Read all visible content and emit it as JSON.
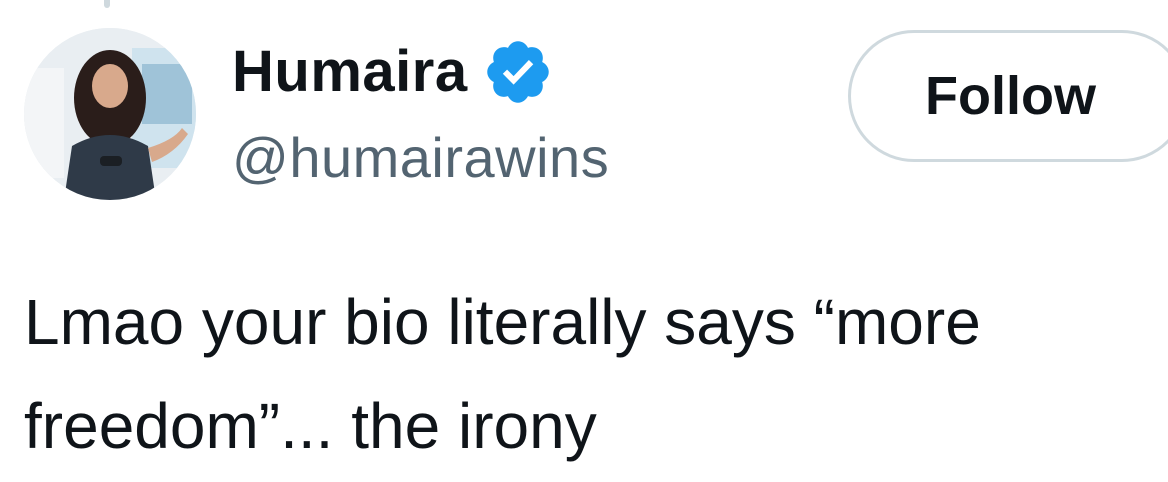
{
  "user": {
    "display_name": "Humaira",
    "handle": "@humairawins",
    "verified": true,
    "verified_color": "#1d9bf0"
  },
  "actions": {
    "follow_label": "Follow"
  },
  "tweet": {
    "lines": [
      "Lmao your bio literally says “more",
      "freedom”... the irony"
    ]
  },
  "icons": {
    "avatar": "profile-photo",
    "verified": "verified-badge-icon"
  },
  "colors": {
    "text": "#0f1419",
    "secondary_text": "#536471",
    "border": "#cfd9de",
    "badge": "#1d9bf0"
  }
}
